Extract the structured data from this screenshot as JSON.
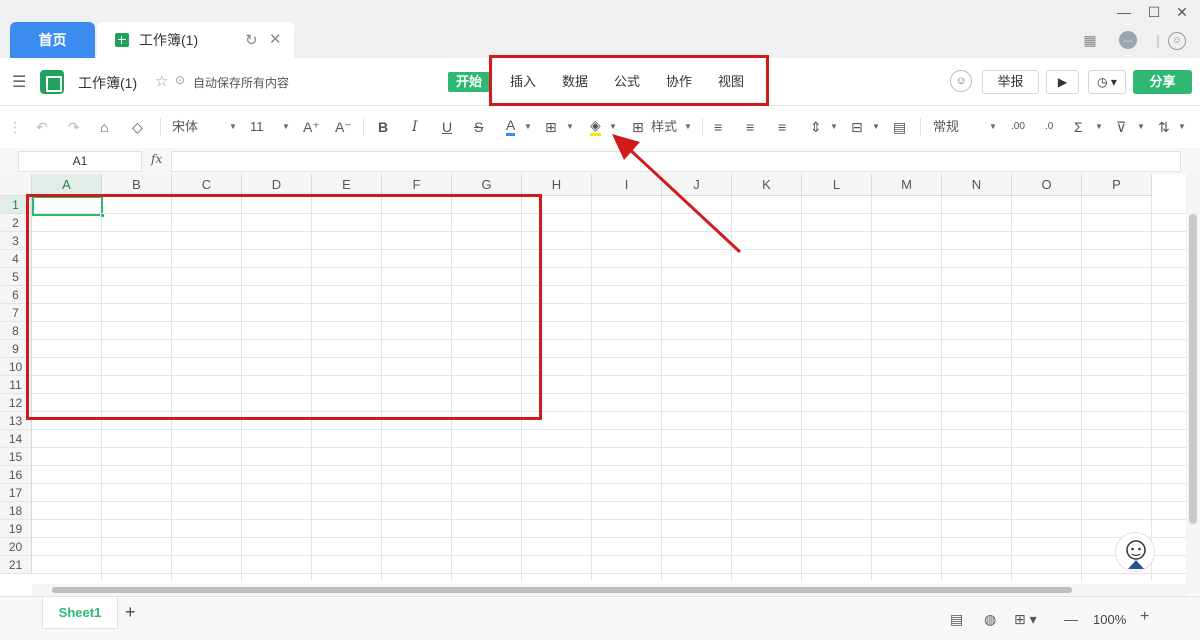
{
  "tabs": {
    "home_label": "首页",
    "doc_label": "工作簿(1)"
  },
  "header": {
    "doc_title": "工作簿(1)",
    "autosave": "自动保存所有内容",
    "menu": [
      "开始",
      "插入",
      "数据",
      "公式",
      "协作",
      "视图"
    ],
    "report": "举报",
    "share": "分享"
  },
  "toolbar": {
    "font_name": "宋体",
    "font_size": "11",
    "style_label": "样式",
    "number_format": "常规",
    "font_color": "#3c8cf0",
    "fill_color": "#ffe600"
  },
  "formula_bar": {
    "name_box": "A1",
    "fx_label": "fx"
  },
  "grid": {
    "columns": [
      "A",
      "B",
      "C",
      "D",
      "E",
      "F",
      "G",
      "H",
      "I",
      "J",
      "K",
      "L",
      "M",
      "N",
      "O",
      "P"
    ],
    "rows": [
      "1",
      "2",
      "3",
      "4",
      "5",
      "6",
      "7",
      "8",
      "9",
      "10",
      "11",
      "12",
      "13",
      "14",
      "15",
      "16",
      "17",
      "18",
      "19",
      "20",
      "21"
    ]
  },
  "bottom": {
    "sheet_name": "Sheet1",
    "add_label": "+",
    "zoom": "100%"
  },
  "colors": {
    "accent": "#2eb872",
    "home_tab": "#3c8cf0",
    "highlight": "#d11a1a"
  }
}
